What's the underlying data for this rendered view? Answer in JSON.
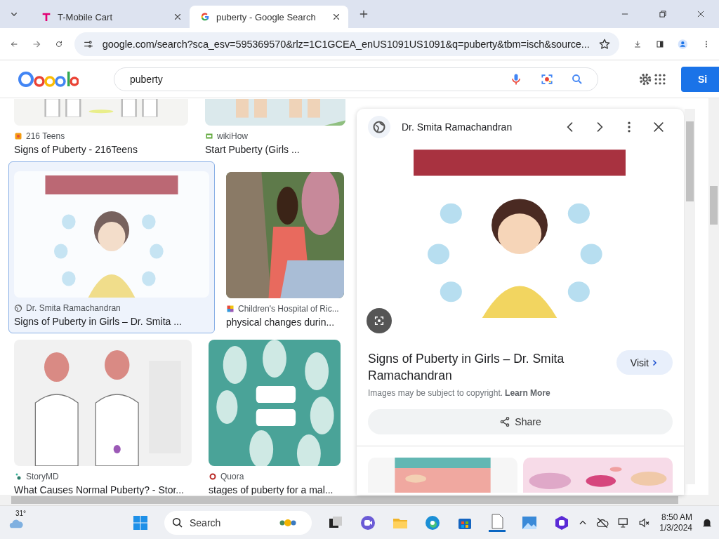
{
  "browser": {
    "tabs": [
      {
        "title": "T-Mobile Cart",
        "selected": false
      },
      {
        "title": "puberty - Google Search",
        "selected": true
      }
    ],
    "address": "google.com/search?sca_esv=595369570&rlz=1C1GCEA_enUS1091US1091&q=puberty&tbm=isch&source..."
  },
  "header": {
    "search_value": "puberty",
    "sign_in": "Si"
  },
  "results": [
    [
      {
        "source": "216 Teens",
        "title": "Signs of Puberty - 216Teens",
        "selected": false
      },
      {
        "source": "wikiHow",
        "title": "Start Puberty (Girls ...",
        "selected": false
      }
    ],
    [
      {
        "source": "Dr. Smita Ramachandran",
        "title": "Signs of Puberty in Girls – Dr. Smita ...",
        "selected": true
      },
      {
        "source": "Children's Hospital of Ric...",
        "title": "physical changes durin...",
        "selected": false
      }
    ],
    [
      {
        "source": "StoryMD",
        "title": "What Causes Normal Puberty? - Stor...",
        "selected": false
      },
      {
        "source": "Quora",
        "title": "stages of puberty for a mal...",
        "selected": false
      }
    ]
  ],
  "panel": {
    "source": "Dr. Smita Ramachandran",
    "title": "Signs of Puberty in Girls – Dr. Smita Ramachandran",
    "visit": "Visit",
    "note": "Images may be subject to copyright.",
    "learn_more": "Learn More",
    "share": "Share"
  },
  "taskbar": {
    "weather": "31°",
    "search": "Search",
    "time": "8:50 AM",
    "date": "1/3/2024"
  }
}
